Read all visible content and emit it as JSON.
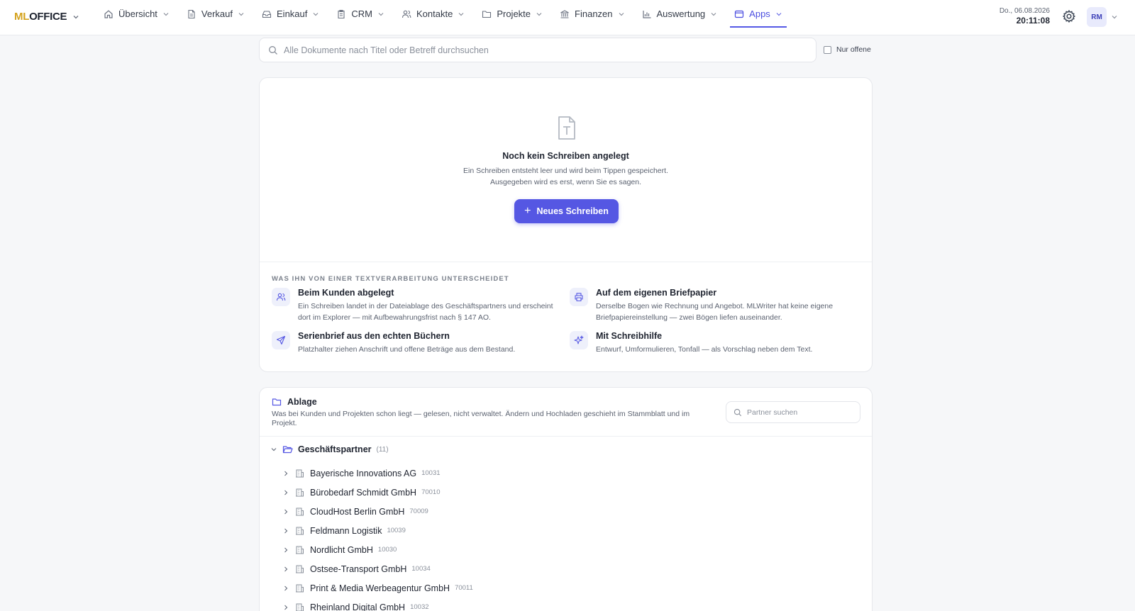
{
  "app": {
    "logo_ml": "ML",
    "logo_office": "OFFICE"
  },
  "nav": [
    {
      "label": "Übersicht",
      "icon": "home-icon"
    },
    {
      "label": "Verkauf",
      "icon": "document-icon"
    },
    {
      "label": "Einkauf",
      "icon": "inbox-icon"
    },
    {
      "label": "CRM",
      "icon": "clipboard-icon"
    },
    {
      "label": "Kontakte",
      "icon": "users-icon"
    },
    {
      "label": "Projekte",
      "icon": "folder-icon"
    },
    {
      "label": "Finanzen",
      "icon": "bank-icon"
    },
    {
      "label": "Auswertung",
      "icon": "bar-chart-icon"
    },
    {
      "label": "Apps",
      "icon": "window-icon",
      "active": true
    }
  ],
  "header": {
    "date": "Do., 06.08.2026",
    "time": "20:11:08",
    "avatar": "RM"
  },
  "search": {
    "placeholder": "Alle Dokumente nach Titel oder Betreff durchsuchen",
    "only_open_label": "Nur offene"
  },
  "empty_state": {
    "title": "Noch kein Schreiben angelegt",
    "text_line1": "Ein Schreiben entsteht leer und wird beim Tippen gespeichert.",
    "text_line2": "Ausgegeben wird es erst, wenn Sie es sagen.",
    "button": "Neues Schreiben"
  },
  "features": {
    "section_label": "WAS IHN VON EINER TEXTVERARBEITUNG UNTERSCHEIDET",
    "items": [
      {
        "icon": "users-icon",
        "title": "Beim Kunden abgelegt",
        "text": "Ein Schreiben landet in der Dateiablage des Geschäftspartners und erscheint dort im Explorer — mit Aufbewahrungsfrist nach § 147 AO."
      },
      {
        "icon": "printer-icon",
        "title": "Auf dem eigenen Briefpapier",
        "text": "Derselbe Bogen wie Rechnung und Angebot. MLWriter hat keine eigene Briefpapiereinstellung — zwei Bögen liefen auseinander."
      },
      {
        "icon": "send-icon",
        "title": "Serienbrief aus den echten Büchern",
        "text": "Platzhalter ziehen Anschrift und offene Beträge aus dem Bestand."
      },
      {
        "icon": "sparkles-icon",
        "title": "Mit Schreibhilfe",
        "text": "Entwurf, Umformulieren, Tonfall — als Vorschlag neben dem Text."
      }
    ]
  },
  "ablage": {
    "title": "Ablage",
    "description": "Was bei Kunden und Projekten schon liegt — gelesen, nicht verwaltet. Ändern und Hochladen geschieht im Stammblatt und im Projekt.",
    "search_placeholder": "Partner suchen",
    "root_label": "Geschäftspartner",
    "root_count": "(11)",
    "partners": [
      {
        "name": "Bayerische Innovations AG",
        "id": "10031"
      },
      {
        "name": "Bürobedarf Schmidt GmbH",
        "id": "70010"
      },
      {
        "name": "CloudHost Berlin GmbH",
        "id": "70009"
      },
      {
        "name": "Feldmann Logistik",
        "id": "10039"
      },
      {
        "name": "Nordlicht GmbH",
        "id": "10030"
      },
      {
        "name": "Ostsee-Transport GmbH",
        "id": "10034"
      },
      {
        "name": "Print & Media Werbeagentur GmbH",
        "id": "70011"
      },
      {
        "name": "Rheinland Digital GmbH",
        "id": "10032"
      }
    ]
  },
  "colors": {
    "accent": "#5557e3",
    "logo_ml": "#d4a21c"
  }
}
